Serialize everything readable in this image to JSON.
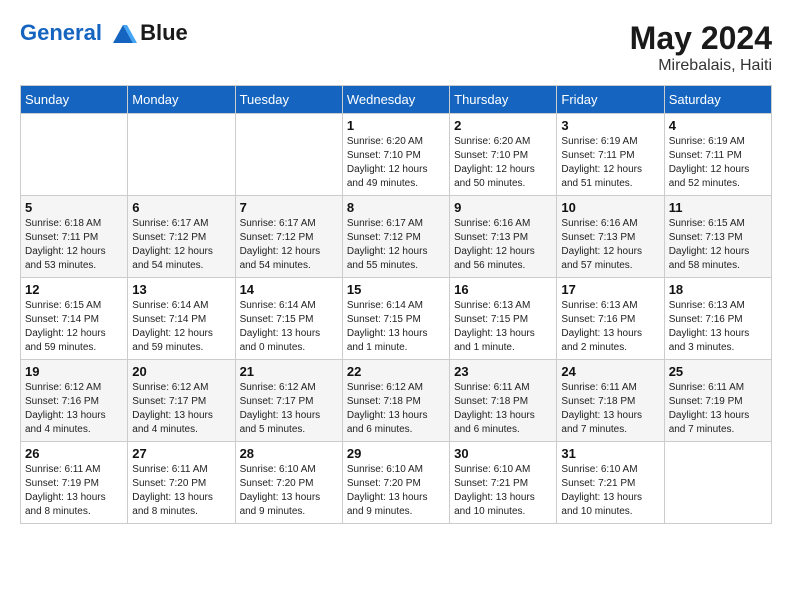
{
  "header": {
    "logo_line1": "General",
    "logo_line2": "Blue",
    "month": "May 2024",
    "location": "Mirebalais, Haiti"
  },
  "days_of_week": [
    "Sunday",
    "Monday",
    "Tuesday",
    "Wednesday",
    "Thursday",
    "Friday",
    "Saturday"
  ],
  "weeks": [
    [
      {
        "day": "",
        "sunrise": "",
        "sunset": "",
        "daylight": ""
      },
      {
        "day": "",
        "sunrise": "",
        "sunset": "",
        "daylight": ""
      },
      {
        "day": "",
        "sunrise": "",
        "sunset": "",
        "daylight": ""
      },
      {
        "day": "1",
        "sunrise": "Sunrise: 6:20 AM",
        "sunset": "Sunset: 7:10 PM",
        "daylight": "Daylight: 12 hours and 49 minutes."
      },
      {
        "day": "2",
        "sunrise": "Sunrise: 6:20 AM",
        "sunset": "Sunset: 7:10 PM",
        "daylight": "Daylight: 12 hours and 50 minutes."
      },
      {
        "day": "3",
        "sunrise": "Sunrise: 6:19 AM",
        "sunset": "Sunset: 7:11 PM",
        "daylight": "Daylight: 12 hours and 51 minutes."
      },
      {
        "day": "4",
        "sunrise": "Sunrise: 6:19 AM",
        "sunset": "Sunset: 7:11 PM",
        "daylight": "Daylight: 12 hours and 52 minutes."
      }
    ],
    [
      {
        "day": "5",
        "sunrise": "Sunrise: 6:18 AM",
        "sunset": "Sunset: 7:11 PM",
        "daylight": "Daylight: 12 hours and 53 minutes."
      },
      {
        "day": "6",
        "sunrise": "Sunrise: 6:17 AM",
        "sunset": "Sunset: 7:12 PM",
        "daylight": "Daylight: 12 hours and 54 minutes."
      },
      {
        "day": "7",
        "sunrise": "Sunrise: 6:17 AM",
        "sunset": "Sunset: 7:12 PM",
        "daylight": "Daylight: 12 hours and 54 minutes."
      },
      {
        "day": "8",
        "sunrise": "Sunrise: 6:17 AM",
        "sunset": "Sunset: 7:12 PM",
        "daylight": "Daylight: 12 hours and 55 minutes."
      },
      {
        "day": "9",
        "sunrise": "Sunrise: 6:16 AM",
        "sunset": "Sunset: 7:13 PM",
        "daylight": "Daylight: 12 hours and 56 minutes."
      },
      {
        "day": "10",
        "sunrise": "Sunrise: 6:16 AM",
        "sunset": "Sunset: 7:13 PM",
        "daylight": "Daylight: 12 hours and 57 minutes."
      },
      {
        "day": "11",
        "sunrise": "Sunrise: 6:15 AM",
        "sunset": "Sunset: 7:13 PM",
        "daylight": "Daylight: 12 hours and 58 minutes."
      }
    ],
    [
      {
        "day": "12",
        "sunrise": "Sunrise: 6:15 AM",
        "sunset": "Sunset: 7:14 PM",
        "daylight": "Daylight: 12 hours and 59 minutes."
      },
      {
        "day": "13",
        "sunrise": "Sunrise: 6:14 AM",
        "sunset": "Sunset: 7:14 PM",
        "daylight": "Daylight: 12 hours and 59 minutes."
      },
      {
        "day": "14",
        "sunrise": "Sunrise: 6:14 AM",
        "sunset": "Sunset: 7:15 PM",
        "daylight": "Daylight: 13 hours and 0 minutes."
      },
      {
        "day": "15",
        "sunrise": "Sunrise: 6:14 AM",
        "sunset": "Sunset: 7:15 PM",
        "daylight": "Daylight: 13 hours and 1 minute."
      },
      {
        "day": "16",
        "sunrise": "Sunrise: 6:13 AM",
        "sunset": "Sunset: 7:15 PM",
        "daylight": "Daylight: 13 hours and 1 minute."
      },
      {
        "day": "17",
        "sunrise": "Sunrise: 6:13 AM",
        "sunset": "Sunset: 7:16 PM",
        "daylight": "Daylight: 13 hours and 2 minutes."
      },
      {
        "day": "18",
        "sunrise": "Sunrise: 6:13 AM",
        "sunset": "Sunset: 7:16 PM",
        "daylight": "Daylight: 13 hours and 3 minutes."
      }
    ],
    [
      {
        "day": "19",
        "sunrise": "Sunrise: 6:12 AM",
        "sunset": "Sunset: 7:16 PM",
        "daylight": "Daylight: 13 hours and 4 minutes."
      },
      {
        "day": "20",
        "sunrise": "Sunrise: 6:12 AM",
        "sunset": "Sunset: 7:17 PM",
        "daylight": "Daylight: 13 hours and 4 minutes."
      },
      {
        "day": "21",
        "sunrise": "Sunrise: 6:12 AM",
        "sunset": "Sunset: 7:17 PM",
        "daylight": "Daylight: 13 hours and 5 minutes."
      },
      {
        "day": "22",
        "sunrise": "Sunrise: 6:12 AM",
        "sunset": "Sunset: 7:18 PM",
        "daylight": "Daylight: 13 hours and 6 minutes."
      },
      {
        "day": "23",
        "sunrise": "Sunrise: 6:11 AM",
        "sunset": "Sunset: 7:18 PM",
        "daylight": "Daylight: 13 hours and 6 minutes."
      },
      {
        "day": "24",
        "sunrise": "Sunrise: 6:11 AM",
        "sunset": "Sunset: 7:18 PM",
        "daylight": "Daylight: 13 hours and 7 minutes."
      },
      {
        "day": "25",
        "sunrise": "Sunrise: 6:11 AM",
        "sunset": "Sunset: 7:19 PM",
        "daylight": "Daylight: 13 hours and 7 minutes."
      }
    ],
    [
      {
        "day": "26",
        "sunrise": "Sunrise: 6:11 AM",
        "sunset": "Sunset: 7:19 PM",
        "daylight": "Daylight: 13 hours and 8 minutes."
      },
      {
        "day": "27",
        "sunrise": "Sunrise: 6:11 AM",
        "sunset": "Sunset: 7:20 PM",
        "daylight": "Daylight: 13 hours and 8 minutes."
      },
      {
        "day": "28",
        "sunrise": "Sunrise: 6:10 AM",
        "sunset": "Sunset: 7:20 PM",
        "daylight": "Daylight: 13 hours and 9 minutes."
      },
      {
        "day": "29",
        "sunrise": "Sunrise: 6:10 AM",
        "sunset": "Sunset: 7:20 PM",
        "daylight": "Daylight: 13 hours and 9 minutes."
      },
      {
        "day": "30",
        "sunrise": "Sunrise: 6:10 AM",
        "sunset": "Sunset: 7:21 PM",
        "daylight": "Daylight: 13 hours and 10 minutes."
      },
      {
        "day": "31",
        "sunrise": "Sunrise: 6:10 AM",
        "sunset": "Sunset: 7:21 PM",
        "daylight": "Daylight: 13 hours and 10 minutes."
      },
      {
        "day": "",
        "sunrise": "",
        "sunset": "",
        "daylight": ""
      }
    ]
  ]
}
